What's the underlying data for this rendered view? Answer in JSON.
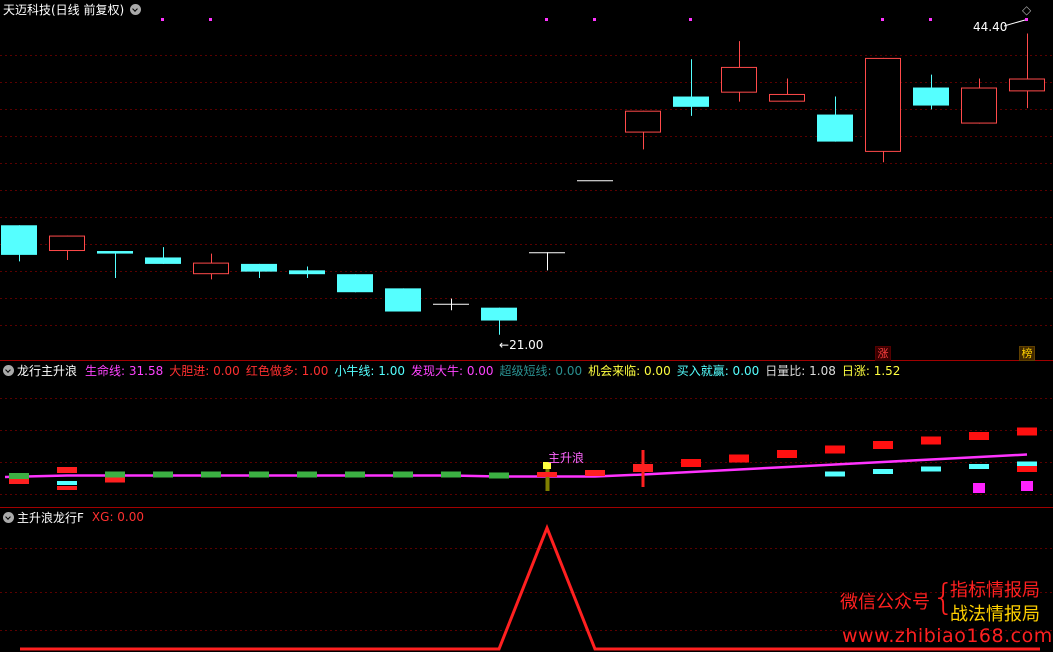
{
  "header": {
    "main_title": "天迈科技(日线 前复权)",
    "panel2_title": "龙行主升浪",
    "panel3_title": "主升浪龙行F"
  },
  "indicators": [
    {
      "label": "生命线",
      "value": "31.58",
      "color": "#ff44ff"
    },
    {
      "label": "大胆进",
      "value": "0.00",
      "color": "#ff3030"
    },
    {
      "label": "红色做多",
      "value": "1.00",
      "color": "#ff3030"
    },
    {
      "label": "小牛线",
      "value": "1.00",
      "color": "#55ffff"
    },
    {
      "label": "发现大牛",
      "value": "0.00",
      "color": "#ff44ff"
    },
    {
      "label": "超级短线",
      "value": "0.00",
      "color": "#2a9090"
    },
    {
      "label": "机会来临",
      "value": "0.00",
      "color": "#ffff40"
    },
    {
      "label": "买入就赢",
      "value": "0.00",
      "color": "#55ffff"
    },
    {
      "label": "日量比",
      "value": "1.08",
      "color": "#dddddd"
    },
    {
      "label": "日涨",
      "value": "1.52",
      "color": "#ffff40"
    }
  ],
  "panel3_indicator": {
    "label": "XG",
    "value": "0.00",
    "color": "#ff3030"
  },
  "badges": {
    "zhang": "涨",
    "bang": "榜"
  },
  "watermark": {
    "line1": "微信公众号",
    "line2": "指标情报局",
    "line3": "战法情报局",
    "url": "www.zhibiao168.com"
  },
  "chart_data": {
    "type": "candlestick",
    "price_annotations": {
      "high": "44.40",
      "low": "21.00"
    },
    "ylim": [
      20.2,
      45.6
    ],
    "candles": [
      {
        "o": 27.2,
        "c": 29.5,
        "h": 29.5,
        "l": 26.7,
        "dir": "down"
      },
      {
        "o": 27.5,
        "c": 28.7,
        "h": 28.7,
        "l": 26.8,
        "dir": "up"
      },
      {
        "o": 27.5,
        "c": 27.3,
        "h": 27.5,
        "l": 25.4,
        "dir": "down"
      },
      {
        "o": 27.0,
        "c": 26.5,
        "h": 27.8,
        "l": 26.5,
        "dir": "down"
      },
      {
        "o": 25.7,
        "c": 26.6,
        "h": 27.3,
        "l": 25.3,
        "dir": "up"
      },
      {
        "o": 26.5,
        "c": 25.9,
        "h": 26.5,
        "l": 25.4,
        "dir": "down"
      },
      {
        "o": 26.0,
        "c": 25.7,
        "h": 26.3,
        "l": 25.4,
        "dir": "down"
      },
      {
        "o": 25.7,
        "c": 24.3,
        "h": 25.7,
        "l": 24.3,
        "dir": "down"
      },
      {
        "o": 24.6,
        "c": 22.8,
        "h": 24.6,
        "l": 22.8,
        "dir": "down"
      },
      {
        "o": 23.4,
        "c": 23.4,
        "h": 23.8,
        "l": 22.9,
        "dir": "flat"
      },
      {
        "o": 23.1,
        "c": 22.1,
        "h": 23.1,
        "l": 21.0,
        "dir": "down"
      },
      {
        "o": 27.4,
        "c": 27.4,
        "h": 27.4,
        "l": 26.0,
        "dir": "flat"
      },
      {
        "o": 33.0,
        "c": 33.0,
        "h": 33.0,
        "l": 33.0,
        "dir": "flat"
      },
      {
        "o": 36.7,
        "c": 38.4,
        "h": 38.4,
        "l": 35.4,
        "dir": "up"
      },
      {
        "o": 39.5,
        "c": 38.7,
        "h": 42.4,
        "l": 38.0,
        "dir": "down"
      },
      {
        "o": 39.8,
        "c": 41.8,
        "h": 43.8,
        "l": 39.1,
        "dir": "up"
      },
      {
        "o": 39.1,
        "c": 39.7,
        "h": 40.9,
        "l": 39.1,
        "dir": "up"
      },
      {
        "o": 38.1,
        "c": 36.0,
        "h": 39.5,
        "l": 36.0,
        "dir": "down"
      },
      {
        "o": 35.2,
        "c": 42.5,
        "h": 42.5,
        "l": 34.4,
        "dir": "up"
      },
      {
        "o": 40.2,
        "c": 38.8,
        "h": 41.2,
        "l": 38.5,
        "dir": "down"
      },
      {
        "o": 37.4,
        "c": 40.2,
        "h": 40.9,
        "l": 37.4,
        "dir": "up"
      },
      {
        "o": 39.9,
        "c": 40.9,
        "h": 44.4,
        "l": 38.6,
        "dir": "up"
      }
    ],
    "sub_indicator": {
      "line_start_index": 0,
      "zhushenglang_label": "主升浪",
      "red_rising_index": 12
    },
    "xg_signal": {
      "peak_index": 11
    }
  }
}
